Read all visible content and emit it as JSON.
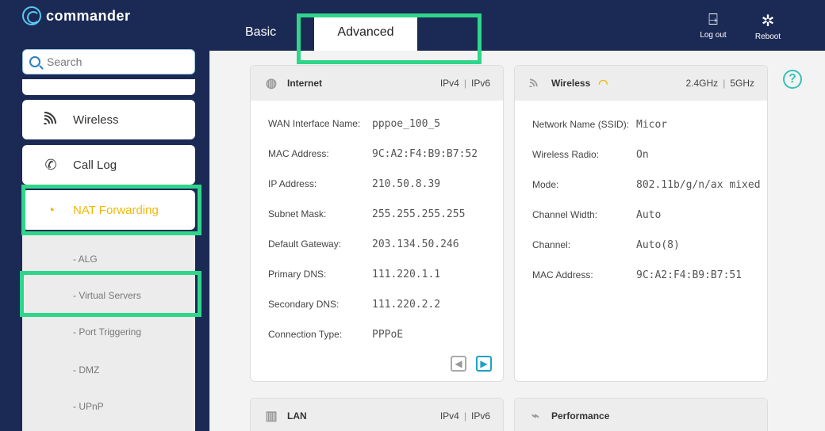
{
  "header": {
    "brand": "commander",
    "tabs": [
      {
        "label": "Basic"
      },
      {
        "label": "Advanced"
      }
    ],
    "logout_label": "Log out",
    "reboot_label": "Reboot"
  },
  "sidebar": {
    "search_placeholder": "Search",
    "items": [
      {
        "label": "Wireless",
        "icon": "wifi-icon"
      },
      {
        "label": "Call Log",
        "icon": "phone-icon"
      },
      {
        "label": "NAT Forwarding",
        "icon": "nat-icon",
        "active": true
      }
    ],
    "subitems": [
      "- ALG",
      "- Virtual Servers",
      "- Port Triggering",
      "- DMZ",
      "- UPnP"
    ]
  },
  "cards": {
    "internet": {
      "title": "Internet",
      "ipv4": "IPv4",
      "ipv6": "IPv6",
      "rows": [
        {
          "label": "WAN Interface Name:",
          "value": "pppoe_100_5"
        },
        {
          "label": "MAC Address:",
          "value": "9C:A2:F4:B9:B7:52"
        },
        {
          "label": "IP Address:",
          "value": "210.50.8.39"
        },
        {
          "label": "Subnet Mask:",
          "value": "255.255.255.255"
        },
        {
          "label": "Default Gateway:",
          "value": "203.134.50.246"
        },
        {
          "label": "Primary DNS:",
          "value": "111.220.1.1"
        },
        {
          "label": "Secondary DNS:",
          "value": "111.220.2.2"
        },
        {
          "label": "Connection Type:",
          "value": "PPPoE"
        }
      ]
    },
    "wireless": {
      "title": "Wireless",
      "band_24": "2.4GHz",
      "band_5": "5GHz",
      "rows": [
        {
          "label": "Network Name (SSID):",
          "value": "Micor"
        },
        {
          "label": "Wireless Radio:",
          "value": "On"
        },
        {
          "label": "Mode:",
          "value": "802.11b/g/n/ax mixed"
        },
        {
          "label": "Channel Width:",
          "value": "Auto"
        },
        {
          "label": "Channel:",
          "value": "Auto(8)"
        },
        {
          "label": "MAC Address:",
          "value": "9C:A2:F4:B9:B7:51"
        }
      ]
    },
    "lan": {
      "title": "LAN",
      "ipv4": "IPv4",
      "ipv6": "IPv6"
    },
    "performance": {
      "title": "Performance"
    }
  },
  "colors": {
    "highlight": "#2fd68a",
    "active": "#f2b80a",
    "navy": "#1b2a55"
  }
}
